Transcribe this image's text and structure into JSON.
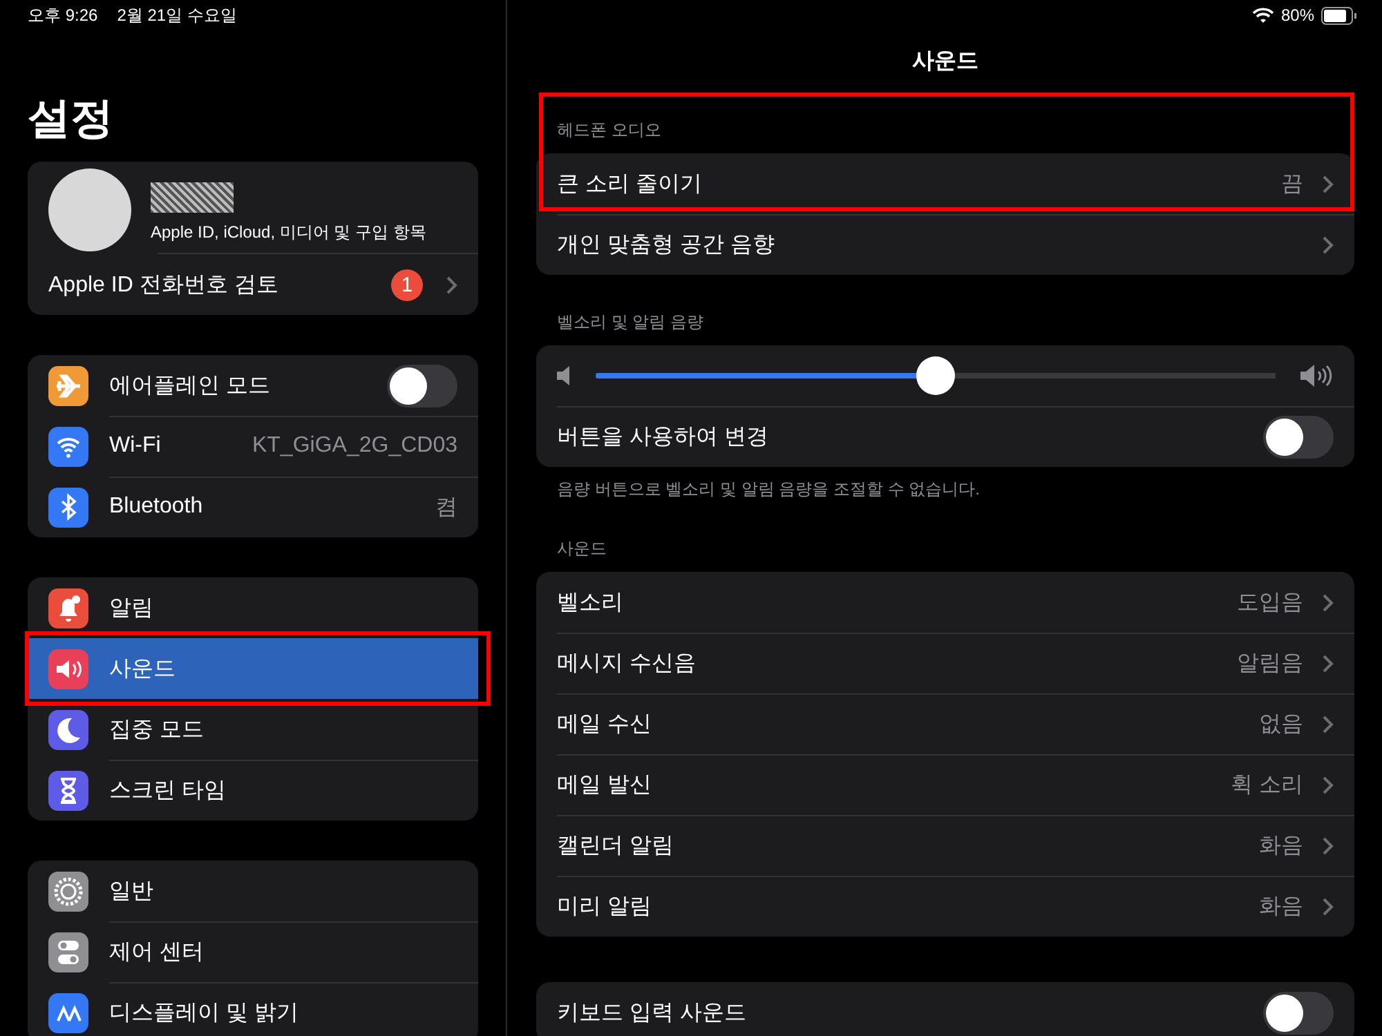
{
  "status_bar": {
    "time": "오후 9:26",
    "date": "2월 21일 수요일",
    "battery": "80%"
  },
  "sidebar": {
    "title": "설정",
    "profile": {
      "subtitle": "Apple ID, iCloud, 미디어 및 구입 항목",
      "review": "Apple ID 전화번호 검토",
      "badge": "1"
    },
    "groups": [
      [
        {
          "kind": "toggle",
          "label": "에어플레인 모드",
          "on": false,
          "selected": false,
          "highlighted": false
        },
        {
          "kind": "value",
          "label": "Wi-Fi",
          "value": "KT_GiGA_2G_CD03",
          "selected": false,
          "highlighted": false
        },
        {
          "kind": "value",
          "label": "Bluetooth",
          "value": "켬",
          "selected": false,
          "highlighted": false
        }
      ],
      [
        {
          "kind": "link",
          "label": "알림",
          "selected": false,
          "highlighted": false
        },
        {
          "kind": "link",
          "label": "사운드",
          "selected": true,
          "highlighted": true
        },
        {
          "kind": "link",
          "label": "집중 모드",
          "selected": false,
          "highlighted": false
        },
        {
          "kind": "link",
          "label": "스크린 타임",
          "selected": false,
          "highlighted": false
        }
      ],
      [
        {
          "kind": "link",
          "label": "일반",
          "selected": false,
          "highlighted": false
        },
        {
          "kind": "link",
          "label": "제어 센터",
          "selected": false,
          "highlighted": false
        },
        {
          "kind": "link",
          "label": "디스플레이 및 밝기",
          "selected": false,
          "highlighted": false
        }
      ]
    ]
  },
  "detail": {
    "title": "사운드",
    "sections": [
      {
        "header": "헤드폰 오디오",
        "highlighted": true,
        "rows": [
          {
            "kind": "link",
            "label": "큰 소리 줄이기",
            "value": "끔"
          },
          {
            "kind": "link",
            "label": "개인 맞춤형 공간 음향"
          }
        ]
      },
      {
        "header": "벨소리 및 알림 음량",
        "highlighted": false,
        "rows": [
          {
            "kind": "slider",
            "level": 0.5
          },
          {
            "kind": "toggle",
            "label": "버튼을 사용하여 변경",
            "on": false
          }
        ],
        "footer": "음량 버튼으로 벨소리 및 알림 음량을 조절할 수 없습니다."
      },
      {
        "header": "사운드",
        "highlighted": false,
        "rows": [
          {
            "kind": "link",
            "label": "벨소리",
            "value": "도입음"
          },
          {
            "kind": "link",
            "label": "메시지 수신음",
            "value": "알림음"
          },
          {
            "kind": "link",
            "label": "메일 수신",
            "value": "없음"
          },
          {
            "kind": "link",
            "label": "메일 발신",
            "value": "휙 소리"
          },
          {
            "kind": "link",
            "label": "캘린더 알림",
            "value": "화음"
          },
          {
            "kind": "link",
            "label": "미리 알림",
            "value": "화음"
          }
        ]
      },
      {
        "highlighted": false,
        "rows": [
          {
            "kind": "toggle",
            "label": "키보드 입력 사운드",
            "on": false
          }
        ]
      }
    ]
  }
}
